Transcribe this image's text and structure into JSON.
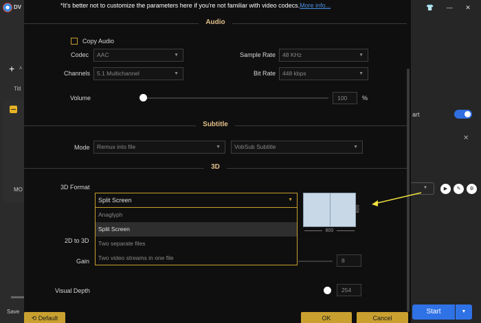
{
  "background_app": {
    "logo_text": "DV",
    "add_label": "+",
    "add_sub": "A",
    "title_partial": "Titl",
    "mo_partial": "MO",
    "save_partial": "Save",
    "art_partial": "art",
    "close_glyph": "✕",
    "start_label": "Start",
    "top_icons": "👕 — ✕"
  },
  "notice": {
    "text": "*It's better not to customize the parameters here if you're not familiar with video codecs.",
    "link": "More info..."
  },
  "audio": {
    "section_title": "Audio",
    "copy_audio_label": "Copy Audio",
    "codec_label": "Codec",
    "codec_value": "AAC",
    "sample_rate_label": "Sample Rate",
    "sample_rate_value": "48 KHz",
    "channels_label": "Channels",
    "channels_value": "5.1 Multichannel",
    "bit_rate_label": "Bit Rate",
    "bit_rate_value": "448 kbps",
    "volume_label": "Volume",
    "volume_value": "100",
    "volume_unit": "%"
  },
  "subtitle": {
    "section_title": "Subtitle",
    "mode_label": "Mode",
    "mode_value": "Remux into file",
    "format_value": "VobSub Subtitle"
  },
  "three_d": {
    "section_title": "3D",
    "format_label": "3D Format",
    "format_value": "Split Screen",
    "options": [
      "Anaglyph",
      "Split Screen",
      "Two separate files",
      "Two video streams in one file"
    ],
    "selected_index": 1,
    "preview_width": "800",
    "preview_height": "600",
    "twod_to_threed_label": "2D to 3D",
    "gain_label": "Gain",
    "gain_value": "8",
    "visual_depth_label": "Visual Depth",
    "visual_depth_value": "254"
  },
  "buttons": {
    "default_label": "Default",
    "ok_label": "OK",
    "cancel_label": "Cancel"
  },
  "colors": {
    "accent": "#c9a030",
    "section_title": "#e2c08a",
    "link": "#4a8fe6",
    "start": "#2f72e6",
    "annotation_arrow": "#f0e040"
  }
}
